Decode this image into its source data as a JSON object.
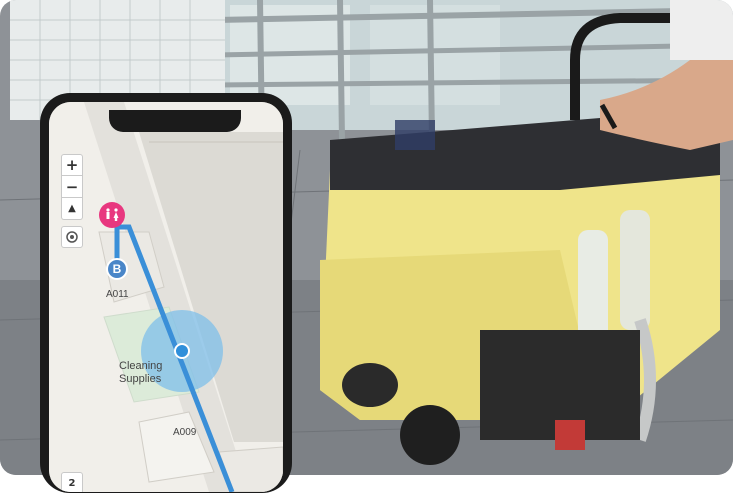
{
  "map_app": {
    "controls": {
      "zoom_in": "+",
      "zoom_out": "−",
      "compass": "▲",
      "floor": "2"
    },
    "restroom_icon": "restroom-icon",
    "marker_label": "B",
    "rooms": {
      "a011": "A011",
      "a009": "A009",
      "cleaning_line1": "Cleaning",
      "cleaning_line2": "Supplies"
    },
    "colors": {
      "route": "#3a8fd8",
      "restroom": "#e8377f",
      "location_halo": "#7fbfea"
    }
  }
}
